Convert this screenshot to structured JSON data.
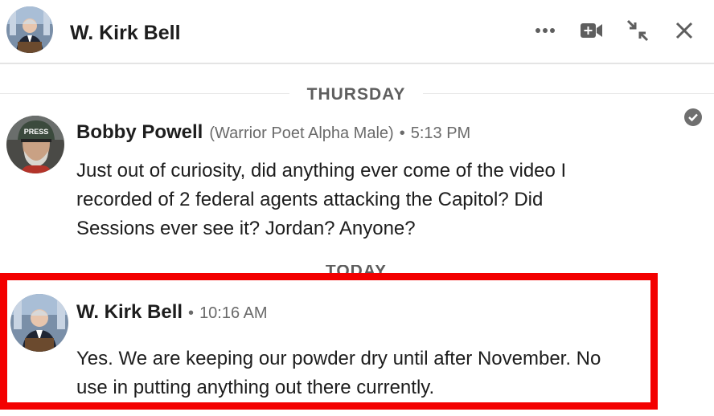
{
  "header": {
    "title": "W. Kirk Bell",
    "icons": [
      "more-icon",
      "video-plus-icon",
      "minimize-icon",
      "close-icon"
    ]
  },
  "dividers": {
    "thursday": "THURSDAY",
    "today": "TODAY"
  },
  "messages": [
    {
      "sender": "Bobby Powell",
      "headline": "(Warrior Poet Alpha Male)",
      "separator": "•",
      "time": "5:13 PM",
      "lines": [
        "Just out of curiosity, did anything ever come of the video I",
        "recorded of 2 federal agents attacking the Capitol?  Did",
        "Sessions ever see it? Jordan? Anyone?"
      ],
      "avatar_badge": "PRESS",
      "status": "read"
    },
    {
      "sender": "W. Kirk Bell",
      "separator": "•",
      "time": "10:16 AM",
      "lines": [
        "Yes. We are keeping our powder dry until after November. No",
        "use in putting anything out there currently."
      ]
    }
  ],
  "colors": {
    "highlight_border": "#f30000",
    "muted_text": "#6a6a6a",
    "divider_line": "#e8e8e8"
  }
}
